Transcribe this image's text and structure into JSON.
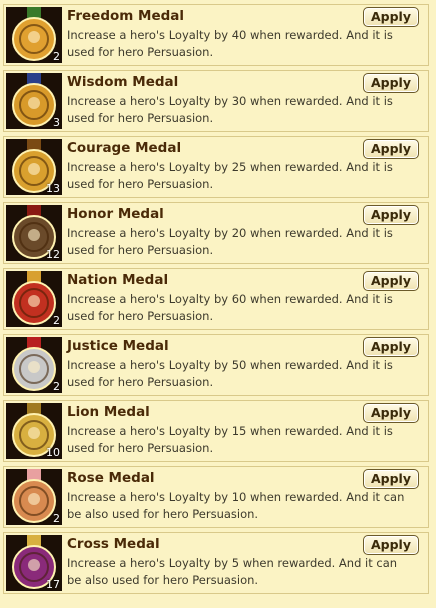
{
  "apply_label": "Apply",
  "items": [
    {
      "name": "Freedom Medal",
      "desc": "Increase a hero's Loyalty by 40 when rewarded. And it is used for hero Persuasion.",
      "qty": "2",
      "icon": "freedom-medal-icon",
      "color": "#e0a030",
      "ribbon": "#3a7a2a"
    },
    {
      "name": "Wisdom Medal",
      "desc": "Increase a hero's Loyalty by 30 when rewarded. And it is used for hero Persuasion.",
      "qty": "3",
      "icon": "wisdom-medal-icon",
      "color": "#d89a2a",
      "ribbon": "#2a3f8a"
    },
    {
      "name": "Courage Medal",
      "desc": "Increase a hero's Loyalty by 25 when rewarded. And it is used for hero Persuasion.",
      "qty": "13",
      "icon": "courage-medal-icon",
      "color": "#d9a02e",
      "ribbon": "#7a4a14"
    },
    {
      "name": "Honor Medal",
      "desc": "Increase a hero's Loyalty by 20 when rewarded. And it is used for hero Persuasion.",
      "qty": "12",
      "icon": "honor-medal-icon",
      "color": "#6a4a2a",
      "ribbon": "#8a1a12"
    },
    {
      "name": "Nation Medal",
      "desc": "Increase a hero's Loyalty by 60 when rewarded. And it is used for hero Persuasion.",
      "qty": "2",
      "icon": "nation-medal-icon",
      "color": "#c23020",
      "ribbon": "#d8a030"
    },
    {
      "name": "Justice Medal",
      "desc": "Increase a hero's Loyalty by 50 when rewarded. And it is used for hero Persuasion.",
      "qty": "2",
      "icon": "justice-medal-icon",
      "color": "#c8c8c8",
      "ribbon": "#b82020"
    },
    {
      "name": "Lion Medal",
      "desc": "Increase a hero's Loyalty by 15 when rewarded. And it is used for hero Persuasion.",
      "qty": "10",
      "icon": "lion-medal-icon",
      "color": "#d8b040",
      "ribbon": "#a07a20"
    },
    {
      "name": "Rose Medal",
      "desc": "Increase a hero's Loyalty by 10 when rewarded. And it can be also used for hero Persuasion.",
      "qty": "2",
      "icon": "rose-medal-icon",
      "color": "#d88a50",
      "ribbon": "#e8a0a0"
    },
    {
      "name": "Cross Medal",
      "desc": "Increase a hero's Loyalty by 5 when rewarded. And it can be also used for hero Persuasion.",
      "qty": "17",
      "icon": "cross-medal-icon",
      "color": "#8a2a7a",
      "ribbon": "#d8b040"
    }
  ]
}
